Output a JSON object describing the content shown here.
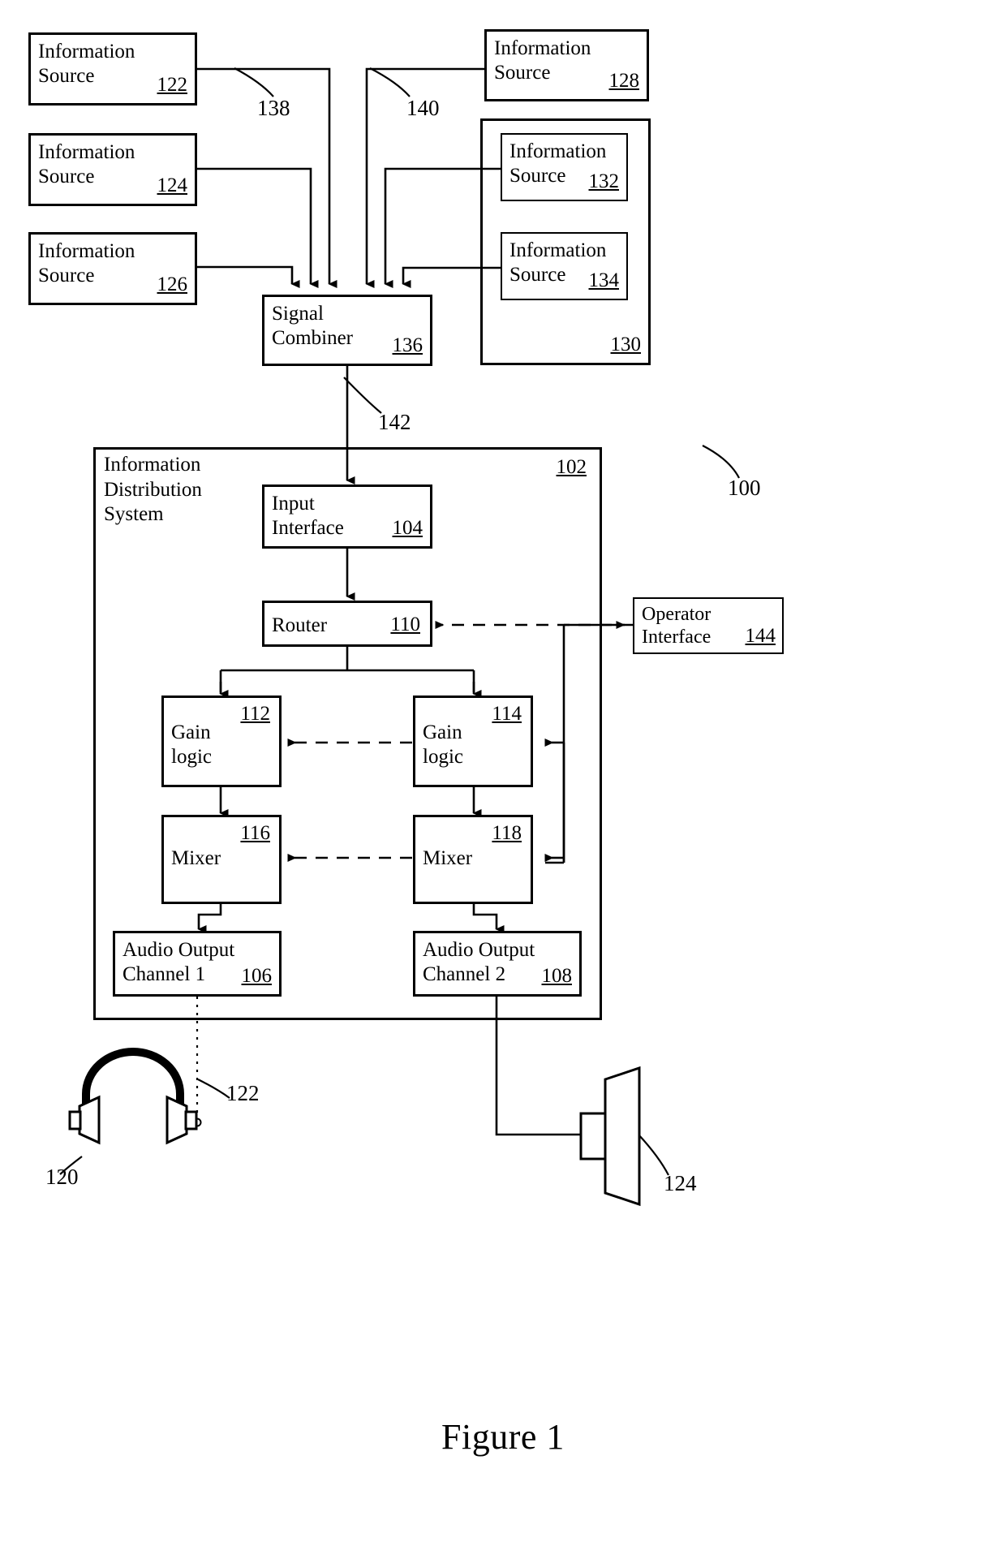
{
  "figure": {
    "caption": "Figure 1",
    "system_reference": "100"
  },
  "information_sources": [
    {
      "id": "src-122",
      "label": "Information\nSource",
      "ref": "122"
    },
    {
      "id": "src-124",
      "label": "Information\nSource",
      "ref": "124"
    },
    {
      "id": "src-126",
      "label": "Information\nSource",
      "ref": "126"
    },
    {
      "id": "src-128",
      "label": "Information\nSource",
      "ref": "128"
    },
    {
      "id": "src-132",
      "label": "Information\nSource",
      "ref": "132"
    },
    {
      "id": "src-134",
      "label": "Information\nSource",
      "ref": "134"
    }
  ],
  "source_group": {
    "label": "",
    "ref": "130"
  },
  "signal_combiner": {
    "label": "Signal\nCombiner",
    "ref": "136"
  },
  "distribution_system": {
    "title": "Information\nDistribution\nSystem",
    "ref": "102"
  },
  "blocks": {
    "input_interface": {
      "label": "Input\nInterface",
      "ref": "104"
    },
    "router": {
      "label": "Router",
      "ref": "110"
    },
    "gain_logic_1": {
      "label": "Gain\nlogic",
      "ref": "112"
    },
    "gain_logic_2": {
      "label": "Gain\nlogic",
      "ref": "114"
    },
    "mixer_1": {
      "label": "Mixer",
      "ref": "116"
    },
    "mixer_2": {
      "label": "Mixer",
      "ref": "118"
    },
    "audio_out_1": {
      "label": "Audio Output\nChannel 1",
      "ref": "106"
    },
    "audio_out_2": {
      "label": "Audio Output\nChannel 2",
      "ref": "108"
    },
    "operator_interface": {
      "label": "Operator\nInterface",
      "ref": "144"
    }
  },
  "lead_labels": {
    "line_138": "138",
    "line_140": "140",
    "line_142": "142",
    "system_100": "100",
    "headphones_120": "120",
    "headphone_lead_122": "122",
    "speaker_124": "124"
  },
  "devices": {
    "headphones": {
      "name": "headphones-icon",
      "ref": "120",
      "lead_ref": "122"
    },
    "speaker": {
      "name": "loudspeaker-icon",
      "ref": "124"
    }
  },
  "colors": {
    "ink": "#000000",
    "paper": "#ffffff"
  }
}
